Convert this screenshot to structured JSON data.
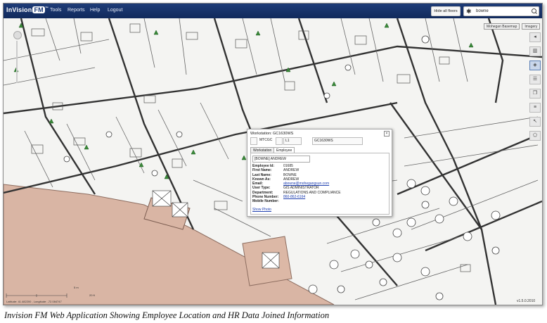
{
  "app": {
    "logo_main": "InVision",
    "logo_fm": "FM",
    "logo_tm": "™"
  },
  "menu": [
    {
      "label": "Tools"
    },
    {
      "label": "Reports"
    },
    {
      "label": "Help"
    },
    {
      "label": "Logout"
    }
  ],
  "toolbar": {
    "hide_floors_label": "Hide all floors",
    "search_value": "bowne"
  },
  "layers": {
    "basemap_label": "Mohegan Basemap",
    "imagery_label": "Imagery"
  },
  "right_tools": [
    "collapse-icon",
    "book-icon",
    "layers-icon",
    "legend-icon",
    "copy-icon",
    "list-icon",
    "pointer-icon",
    "polygon-icon"
  ],
  "popup": {
    "title": "Workstation: GC1630WS",
    "site": "MTCGC",
    "floor": "L1",
    "workstation": "GC1630WS",
    "tabs": [
      "Workstation",
      "Employee Info"
    ],
    "employee_select": "[BOWNE] ANDREW",
    "fields": [
      {
        "label": "Employee Id:",
        "value": "01685"
      },
      {
        "label": "First Name:",
        "value": "ANDREW"
      },
      {
        "label": "Last Name:",
        "value": "BOWNE"
      },
      {
        "label": "Known As:",
        "value": "ANDREW"
      },
      {
        "label": "Email:",
        "value": "abowne@mohegangsun.com",
        "link": true
      },
      {
        "label": "User Type:",
        "value": "GIS ADMINISTRATOR"
      },
      {
        "label": "Department:",
        "value": "REGULATIONS AND COMPLIANCE"
      },
      {
        "label": "Phone Number:",
        "value": "860-862-6164",
        "link": true
      },
      {
        "label": "Mobile Number:",
        "value": ""
      }
    ],
    "show_photo": "Show Photo"
  },
  "scale": {
    "label": "5 m",
    "label2": "20 ft"
  },
  "coords": "Latitude: 41.482200 , Longitude: -72.084747",
  "version": "v1.5.0.2010",
  "caption": "Invision FM Web Application Showing Employee Location and HR Data Joined Information"
}
